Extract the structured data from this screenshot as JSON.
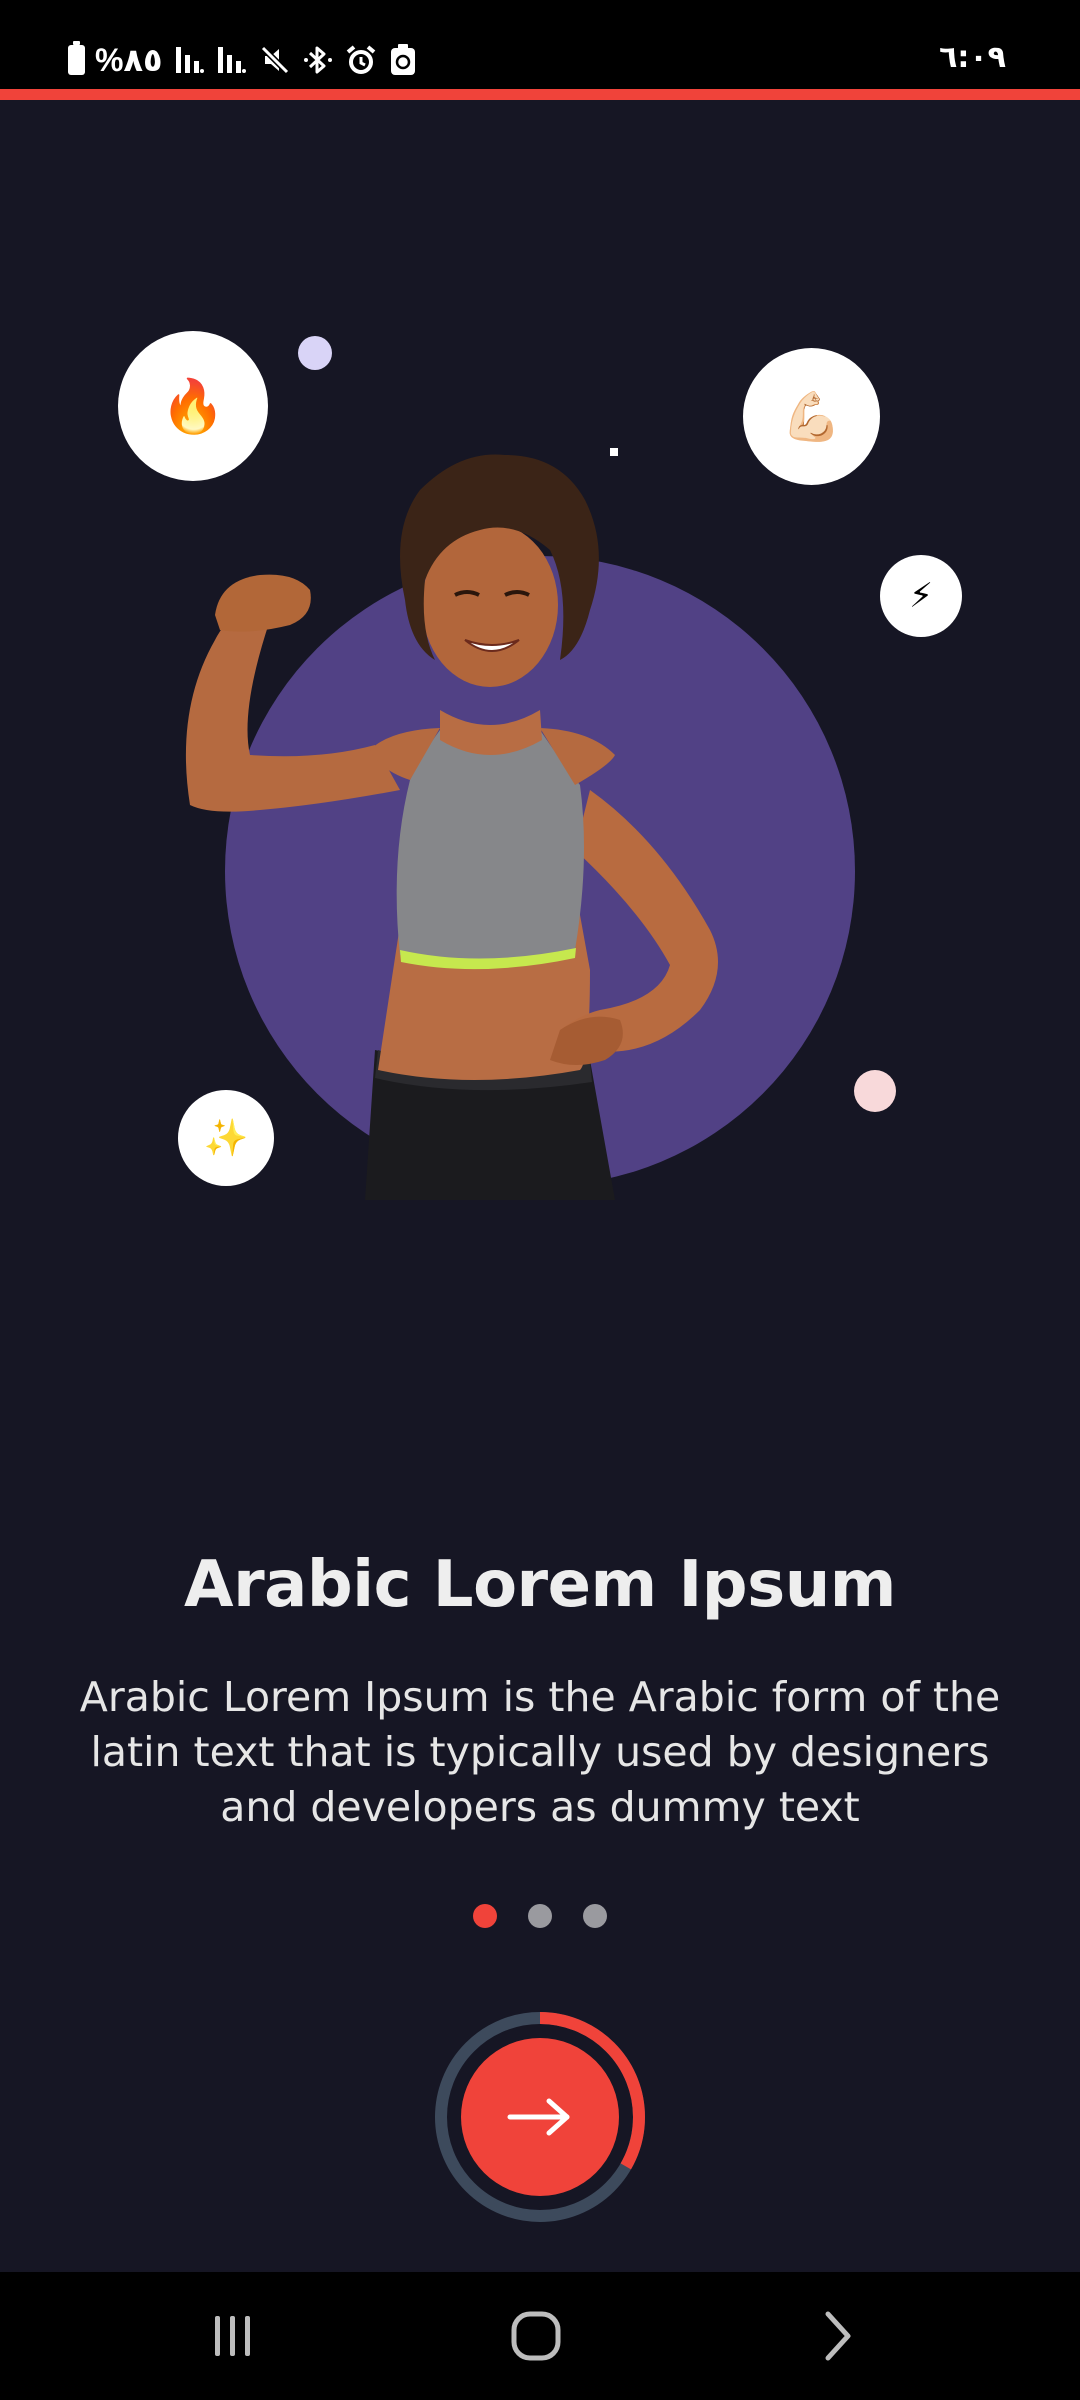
{
  "status_bar": {
    "battery_text": "%٨٥",
    "time": "٦:٠٩",
    "icons": [
      "battery-icon",
      "signal-icon",
      "signal-icon",
      "mute-icon",
      "bluetooth-icon",
      "alarm-icon",
      "recycle-icon"
    ]
  },
  "onboarding": {
    "title": "Arabic Lorem Ipsum",
    "description": "Arabic Lorem Ipsum is the Arabic form of the latin text that is typically used by designers and developers as dummy text",
    "page_indicator": {
      "total": 3,
      "current": 1
    },
    "next_button": {
      "icon": "arrow-right-icon",
      "progress_fraction": 0.333
    },
    "decorations": {
      "bubbles": [
        "🔥",
        "💪🏻",
        "⚡",
        "✨"
      ]
    }
  },
  "colors": {
    "background": "#161624",
    "accent": "#f0433a",
    "hero_circle": "#514185",
    "ring_track": "#3d4a5c",
    "dot_inactive": "#9a9a9f"
  },
  "nav_bar": {
    "icons": [
      "recents-icon",
      "home-icon",
      "back-icon"
    ]
  }
}
